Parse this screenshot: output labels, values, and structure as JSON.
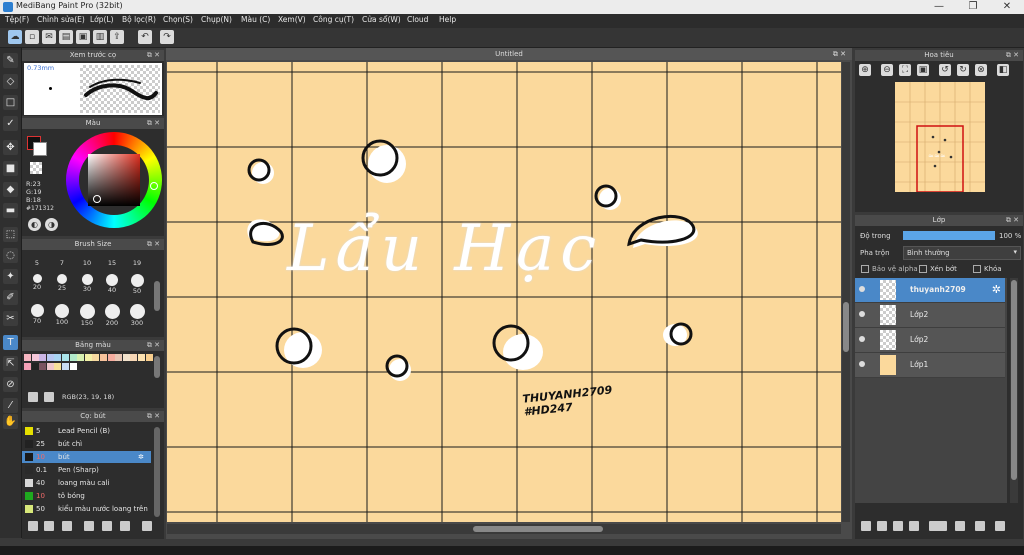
{
  "window": {
    "title": "MediBang Paint Pro (32bit)",
    "controls": [
      "—",
      "❐",
      "✕"
    ]
  },
  "menu": [
    "Tệp(F)",
    "Chỉnh sửa(E)",
    "Lớp(L)",
    "Bộ lọc(R)",
    "Chọn(S)",
    "Chụp(N)",
    "Màu (C)",
    "Xem(V)",
    "Công cụ(T)",
    "Cửa sổ(W)",
    "Cloud",
    "Help"
  ],
  "canvas": {
    "tab_title": "Untitled",
    "background_color": "#fbd99c",
    "lettering": "Lẩu Hạc",
    "signature_line1": "THUYANH2709",
    "signature_line2": "#HD247"
  },
  "brush_preview": {
    "title": "Xem trước cọ",
    "size_label": "0.73mm"
  },
  "color_panel": {
    "title": "Màu",
    "r_label": "R:23",
    "g_label": "G:19",
    "b_label": "B:18",
    "hex_label": "#171312",
    "current_color": "#171312"
  },
  "brush_size": {
    "title": "Brush Size",
    "sizes": [
      "5",
      "7",
      "10",
      "15",
      "19",
      "20",
      "25",
      "30",
      "40",
      "50",
      "70",
      "100",
      "150",
      "200",
      "300"
    ]
  },
  "palette": {
    "title": "Bảng màu",
    "rgb_label": "RGB(23, 19, 18)",
    "row1": [
      "#f7b6c2",
      "#f5c6d9",
      "#cbb6e6",
      "#b6c7f2",
      "#a8d4f3",
      "#a9e4ea",
      "#b1e9c9",
      "#d6f0b0",
      "#f3f1a7",
      "#f6d9a0",
      "#f8c39c",
      "#f6ad9f",
      "#e8c6b4",
      "#f2e2cc",
      "#f7d7b5",
      "#fde2b0",
      "#f9cf8e"
    ],
    "row2": [
      "#f5a0b6",
      "#222222",
      "#7a5560",
      "#f0c8cc",
      "#f7e19b",
      "#c7dcf3",
      "#ffffff"
    ]
  },
  "brushes": {
    "title": "Cọ: bút",
    "items": [
      {
        "num": "5",
        "name": "Lead Pencil (B)",
        "color": "#e6e000"
      },
      {
        "num": "25",
        "name": "bút chì",
        "color": "#222222"
      },
      {
        "num": "10",
        "name": "bút",
        "color": "#1a1a1a",
        "selected": true
      },
      {
        "num": "0.1",
        "name": "Pen (Sharp)",
        "color": "#2a2a2a"
      },
      {
        "num": "40",
        "name": "loang màu cali",
        "color": "#d8d8d8"
      },
      {
        "num": "10",
        "name": "tô bóng",
        "color": "#1fa81f"
      },
      {
        "num": "50",
        "name": "kiểu màu nước loang trên",
        "color": "#d8e87a"
      }
    ]
  },
  "navigator": {
    "title": "Hoa tiêu"
  },
  "layers_panel": {
    "title": "Lớp",
    "opacity_label": "Độ trong",
    "opacity_value": "100 %",
    "opacity": 1.0,
    "blend_label": "Pha trộn",
    "blend_value": "Bình thường",
    "protect_alpha": "Bảo vệ alpha",
    "clipping": "Xén bớt",
    "lock": "Khóa",
    "layers": [
      {
        "name": "thuyanh2709",
        "selected": true
      },
      {
        "name": "Lớp2"
      },
      {
        "name": "Lớp2"
      },
      {
        "name": "Lớp1"
      }
    ]
  }
}
